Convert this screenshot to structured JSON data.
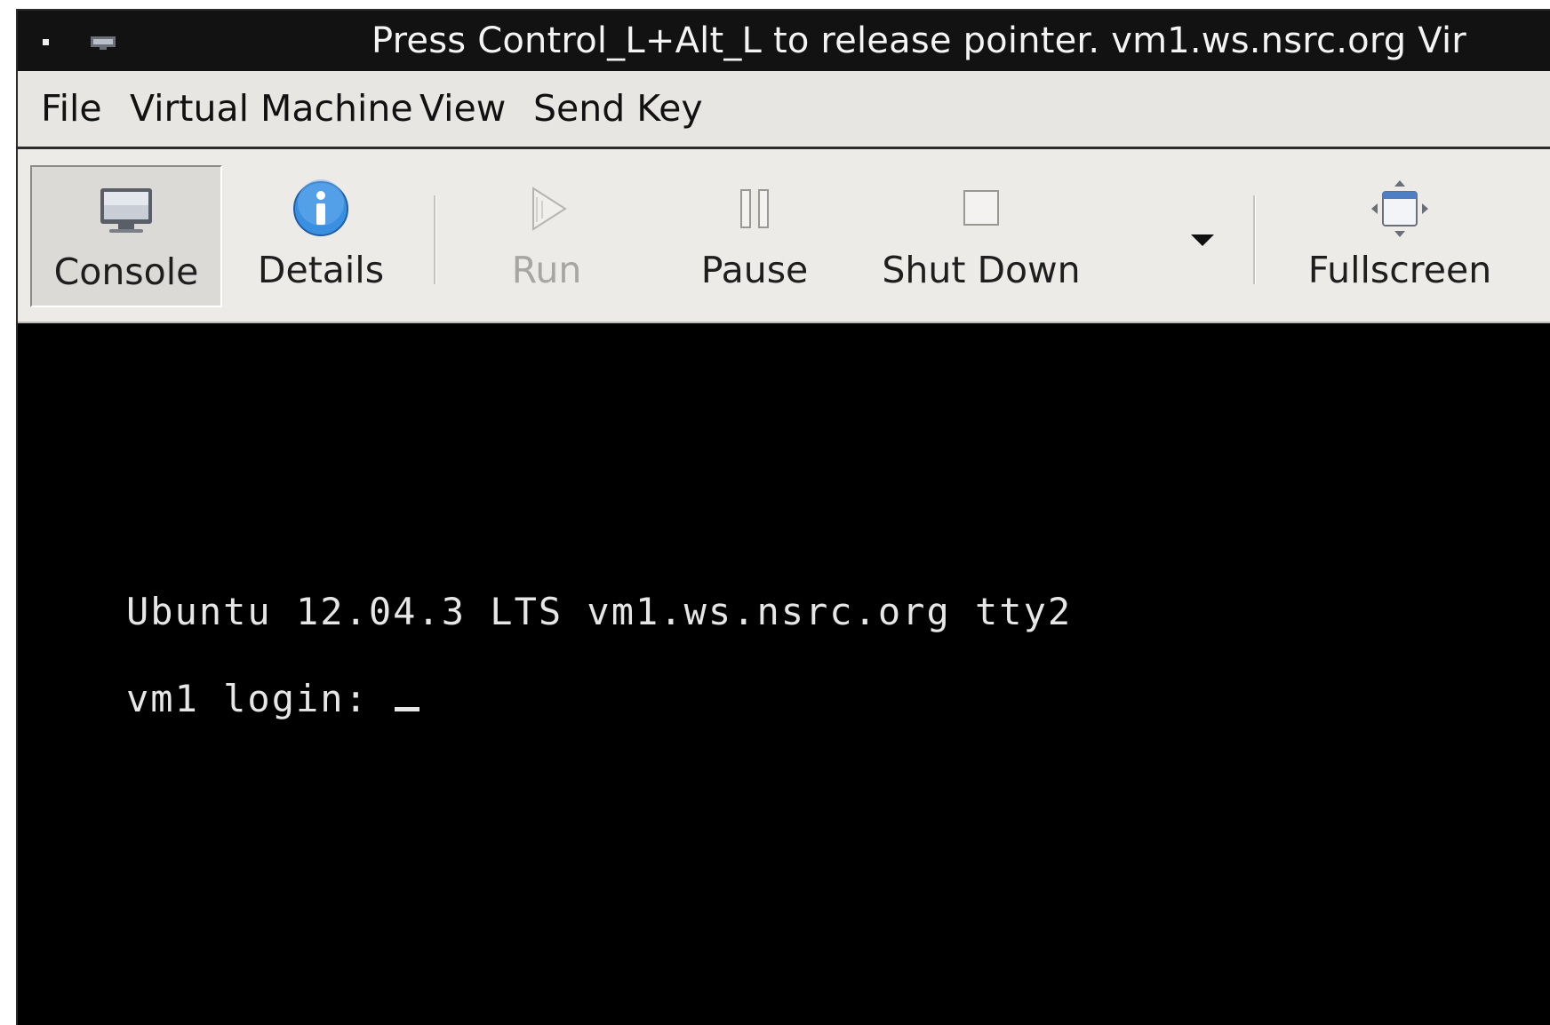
{
  "titlebar": {
    "title": "Press Control_L+Alt_L to release pointer. vm1.ws.nsrc.org Vir"
  },
  "menubar": {
    "items": [
      "File",
      "Virtual Machine",
      "View",
      "Send Key"
    ]
  },
  "toolbar": {
    "buttons": [
      {
        "label": "Console",
        "icon": "monitor-icon",
        "state": "active"
      },
      {
        "label": "Details",
        "icon": "info-icon",
        "state": "normal"
      },
      {
        "label": "Run",
        "icon": "play-icon",
        "state": "disabled"
      },
      {
        "label": "Pause",
        "icon": "pause-icon",
        "state": "normal"
      },
      {
        "label": "Shut Down",
        "icon": "stop-icon",
        "state": "normal"
      },
      {
        "label": "Fullscreen",
        "icon": "fullscreen-icon",
        "state": "normal"
      }
    ]
  },
  "console": {
    "banner": "Ubuntu 12.04.3 LTS vm1.ws.nsrc.org tty2",
    "prompt": "vm1 login: "
  },
  "colors": {
    "titlebar_bg": "#121212",
    "toolbar_bg": "#ecebe8",
    "console_bg": "#000000",
    "console_fg": "#e6e6e6",
    "info_blue": "#3b8fe0"
  }
}
